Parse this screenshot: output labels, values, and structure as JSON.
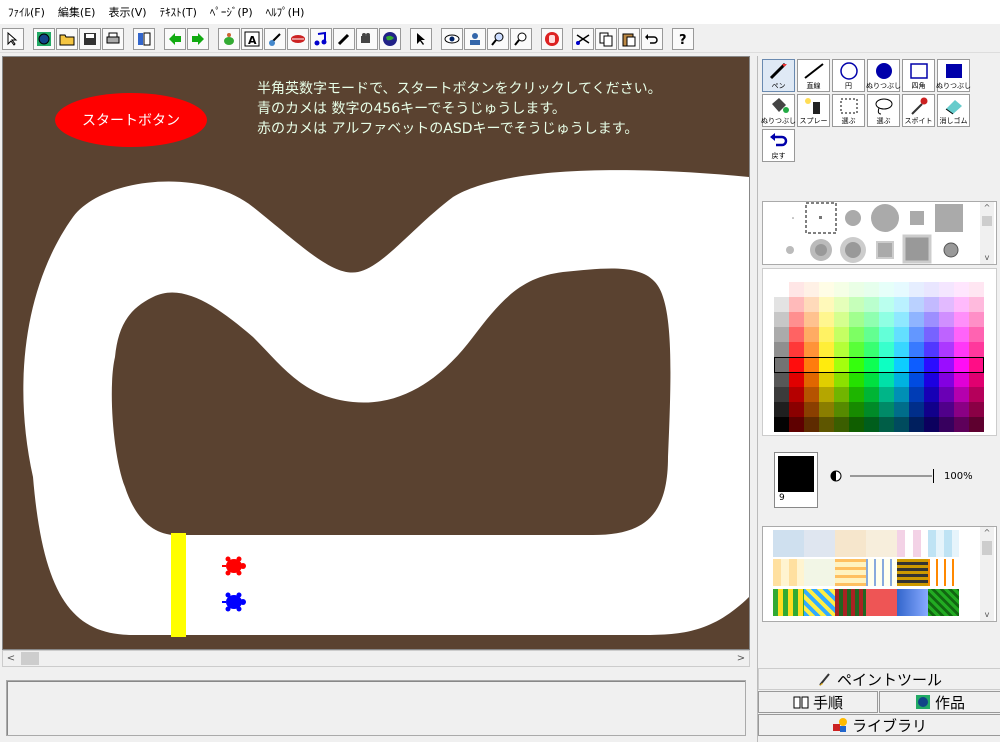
{
  "menu": [
    "ﾌｧｲﾙ(F)",
    "編集(E)",
    "表示(V)",
    "ﾃｷｽﾄ(T)",
    "ﾍﾟｰｼﾞ(P)",
    "ﾍﾙﾌﾟ(H)"
  ],
  "canvas": {
    "start_button_label": "スタートボタン",
    "instructions": [
      "半角英数字モードで、スタートボタンをクリックしてください。",
      "青のカメは 数字の456キーでそうじゅうします。",
      "赤のカメは アルファベットのASDキーでそうじゅうします。"
    ]
  },
  "colors": {
    "background": "#5a4230",
    "track": "#ffffff",
    "start_button": "#ff0000",
    "start_line": "#ffff00",
    "red_turtle": "#ff0000",
    "blue_turtle": "#0000ff"
  },
  "tools": [
    {
      "icon": "pen-icon",
      "label": "ペン",
      "active": true
    },
    {
      "icon": "line-icon",
      "label": "直線"
    },
    {
      "icon": "circle-icon",
      "label": "円"
    },
    {
      "icon": "filled-circle-icon",
      "label": "ぬりつぶし"
    },
    {
      "icon": "rectangle-icon",
      "label": "四角"
    },
    {
      "icon": "filled-rectangle-icon",
      "label": "ぬりつぶし"
    },
    {
      "icon": "bucket-icon",
      "label": "ぬりつぶし"
    },
    {
      "icon": "spray-icon",
      "label": "スプレー"
    },
    {
      "icon": "select-rect-icon",
      "label": "選ぶ"
    },
    {
      "icon": "lasso-icon",
      "label": "選ぶ"
    },
    {
      "icon": "eyedropper-icon",
      "label": "スポイト"
    },
    {
      "icon": "eraser-icon",
      "label": "消しゴム"
    },
    {
      "icon": "undo-icon",
      "label": "戻す"
    }
  ],
  "current_color": {
    "number": "9",
    "hex": "#000000"
  },
  "opacity": "100%",
  "panel_tabs": {
    "paint_tool": "ペイントツール",
    "steps": "手順",
    "works": "作品",
    "library": "ライブラリ"
  },
  "toolbar_icons": [
    "cursor-icon",
    "globe-icon",
    "open-folder-icon",
    "save-icon",
    "print-icon",
    "layout-icon",
    "back-arrow-icon",
    "forward-arrow-icon",
    "turtle-icon",
    "text-icon",
    "stamp-icon",
    "lips-icon",
    "music-icon",
    "pencil-icon",
    "movie-icon",
    "earth-icon",
    "pointer-icon",
    "eye-icon",
    "person-icon",
    "zoom-in-icon",
    "zoom-out-icon",
    "hand-stop-icon",
    "scissors-icon",
    "copy-icon",
    "paste-icon",
    "undo-icon",
    "help-icon"
  ]
}
